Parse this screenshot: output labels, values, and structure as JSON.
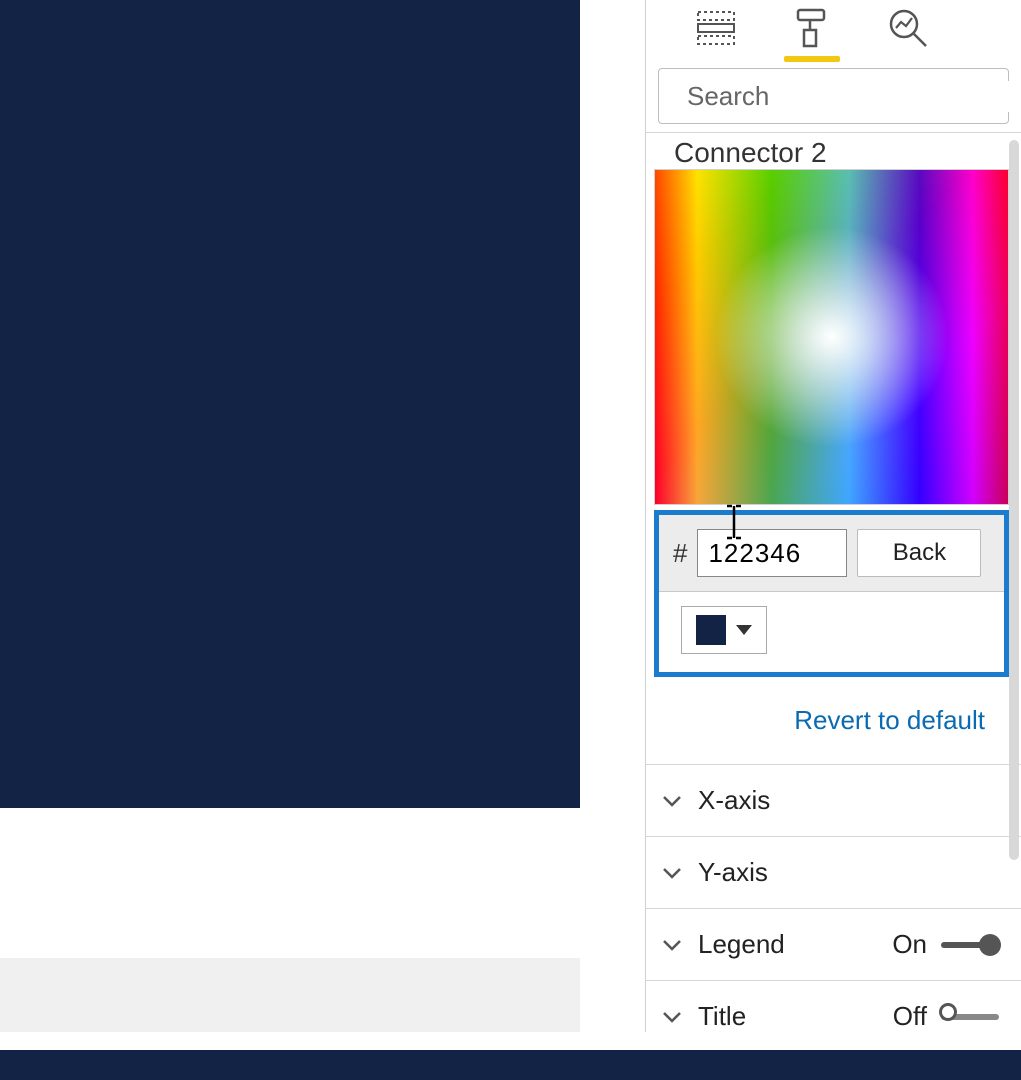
{
  "colors": {
    "canvas": "#122346",
    "accent": "#f2c811",
    "highlight_border": "#1b7bcc",
    "link": "#0a6bb2"
  },
  "tabs": {
    "fields_icon": "fields-icon",
    "format_icon": "format-icon",
    "analytics_icon": "analytics-icon",
    "active": "format"
  },
  "search": {
    "placeholder": "Search",
    "value": ""
  },
  "data_colors": {
    "section_label_partial": "Connector 2",
    "hex_prefix": "#",
    "hex_value": "122346",
    "back_label": "Back",
    "swatch_color": "#122346",
    "revert_label": "Revert to default"
  },
  "accordion": [
    {
      "label": "X-axis",
      "toggle": null
    },
    {
      "label": "Y-axis",
      "toggle": null
    },
    {
      "label": "Legend",
      "toggle": {
        "state_label": "On",
        "on": true
      }
    },
    {
      "label": "Title",
      "toggle": {
        "state_label": "Off",
        "on": false
      }
    }
  ]
}
